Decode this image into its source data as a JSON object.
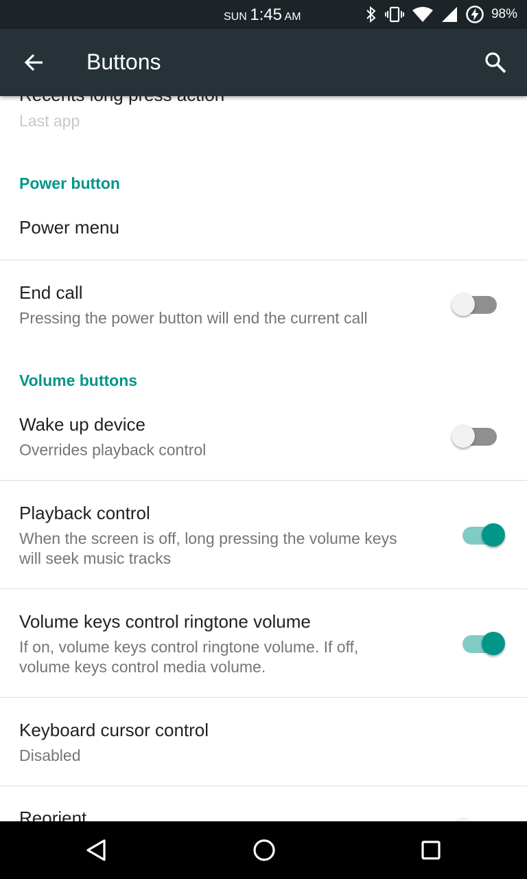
{
  "status_bar": {
    "day": "SUN",
    "time": "1:45",
    "ampm": "AM",
    "battery": "98%"
  },
  "app_bar": {
    "title": "Buttons"
  },
  "items": {
    "recents_long_press": {
      "title": "Recents long press action",
      "subtitle": "Last app"
    },
    "power_section": "Power button",
    "power_menu": {
      "title": "Power menu"
    },
    "end_call": {
      "title": "End call",
      "subtitle": "Pressing the power button will end the current call",
      "enabled": false
    },
    "volume_section": "Volume buttons",
    "wake_up": {
      "title": "Wake up device",
      "subtitle": "Overrides playback control",
      "enabled": false
    },
    "playback": {
      "title": "Playback control",
      "subtitle_line1": "When the screen is off, long pressing the volume keys",
      "subtitle_line2": "will seek music tracks",
      "enabled": true
    },
    "ringtone": {
      "title": "Volume keys control ringtone volume",
      "subtitle_line1": "If on, volume keys control ringtone volume. If off,",
      "subtitle_line2": "volume keys control media volume.",
      "enabled": true
    },
    "cursor": {
      "title": "Keyboard cursor control",
      "subtitle": "Disabled"
    },
    "reorient": {
      "title": "Reorient"
    }
  },
  "colors": {
    "accent": "#009688",
    "app_bar": "#263238",
    "status_bar": "#1c2428"
  }
}
